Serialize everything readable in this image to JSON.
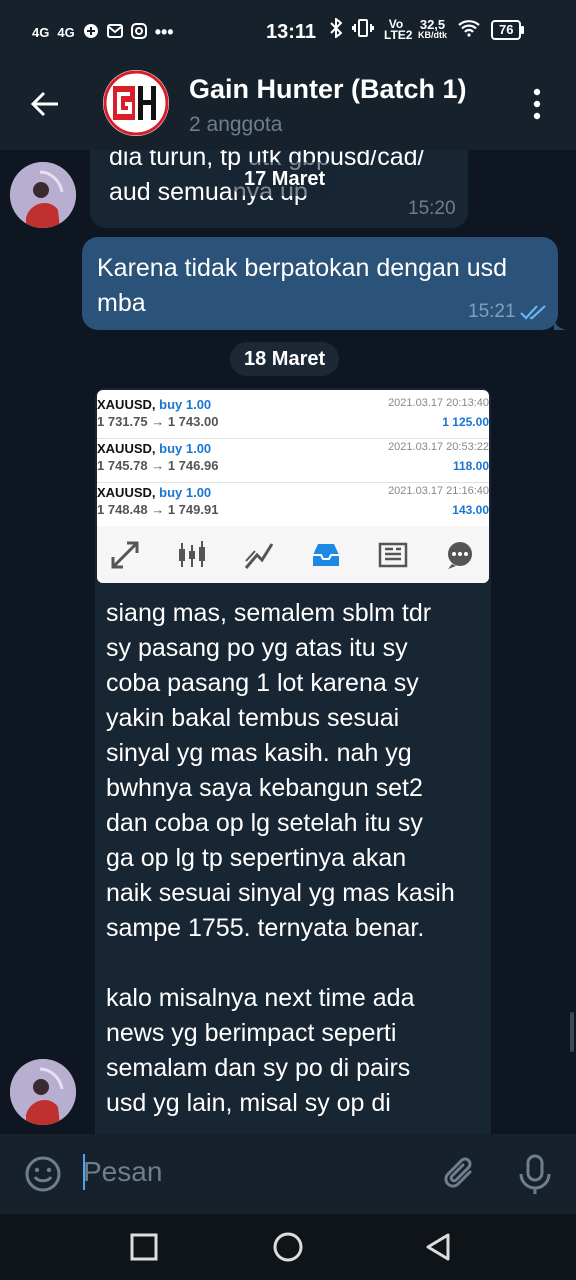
{
  "status_bar": {
    "signal1": "4G",
    "signal2": "4G",
    "time": "13:11",
    "volte": "Vo LTE2",
    "speed_value": "32,5",
    "speed_unit": "KB/dtk",
    "battery": "76"
  },
  "header": {
    "avatar_letters": "GH",
    "title": "Gain Hunter (Batch 1)",
    "subtitle": "2 anggota"
  },
  "date_pill_1": "17 Maret",
  "date_pill_2": "18 Maret",
  "messages": [
    {
      "direction": "incoming",
      "text_line1": "dia turun, tp utk gbpusd/cad/",
      "text_line2": "aud semuanya up",
      "time": "15:20"
    },
    {
      "direction": "outgoing",
      "text_line1": "Karena tidak berpatokan dengan usd",
      "text_line2": "mba",
      "time": "15:21",
      "status": "read"
    }
  ],
  "screenshot_trades": [
    {
      "symbol": "XAUUSD,",
      "side": "buy 1.00",
      "price": "1 731.75 → 1 743.00",
      "datetime": "2021.03.17 20:13:40",
      "profit": "1 125.00"
    },
    {
      "symbol": "XAUUSD,",
      "side": "buy 1.00",
      "price": "1 745.78 → 1 746.96",
      "datetime": "2021.03.17 20:53:22",
      "profit": "118.00"
    },
    {
      "symbol": "XAUUSD,",
      "side": "buy 1.00",
      "price": "1 748.48 → 1 749.91",
      "datetime": "2021.03.17 21:16:40",
      "profit": "143.00"
    }
  ],
  "screenshot_toolbar_icons": [
    "trade-arrows-icon",
    "candlestick-icon",
    "chart-line-icon",
    "inbox-icon",
    "news-icon",
    "chat-icon"
  ],
  "screenshot_caption": {
    "p1_lines": [
      "siang mas, semalem sblm tdr",
      "sy pasang po yg atas itu sy",
      "coba pasang 1 lot karena sy",
      "yakin bakal tembus sesuai",
      "sinyal yg mas kasih. nah yg",
      "bwhnya saya kebangun set2",
      "dan coba op lg setelah itu sy",
      "ga op lg tp sepertinya akan",
      "naik sesuai sinyal yg mas kasih",
      "sampe 1755. ternyata benar."
    ],
    "p2_lines": [
      "kalo misalnya next time ada",
      "news yg berimpact seperti",
      "semalam dan sy po di pairs",
      "usd yg lain, misal sy op di"
    ]
  },
  "composer": {
    "placeholder": "Pesan"
  },
  "colors": {
    "background": "#0e1621",
    "header": "#17212b",
    "incoming_bubble": "#182533",
    "outgoing_bubble": "#2b5278",
    "accent": "#4ea4f6"
  }
}
